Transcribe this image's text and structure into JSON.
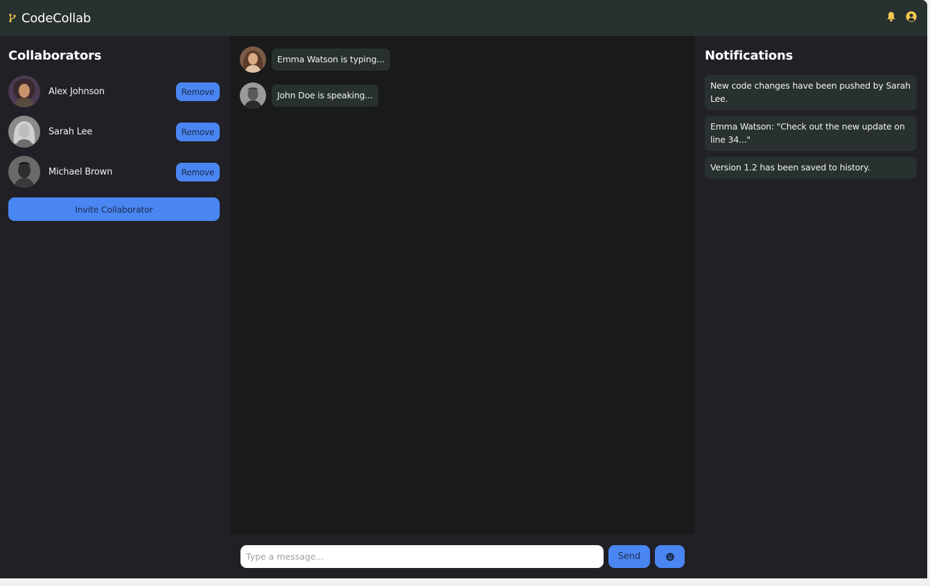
{
  "app": {
    "title": "CodeCollab"
  },
  "collaborators": {
    "title": "Collaborators",
    "items": [
      {
        "name": "Alex Johnson",
        "action": "Remove"
      },
      {
        "name": "Sarah Lee",
        "action": "Remove"
      },
      {
        "name": "Michael Brown",
        "action": "Remove"
      }
    ],
    "invite_label": "Invite Collaborator"
  },
  "chat": {
    "messages": [
      {
        "text": "Emma Watson is typing..."
      },
      {
        "text": "John Doe is speaking..."
      }
    ],
    "input_placeholder": "Type a message...",
    "send_label": "Send"
  },
  "notifications": {
    "title": "Notifications",
    "items": [
      {
        "text": "New code changes have been pushed by Sarah Lee."
      },
      {
        "text": "Emma Watson: \"Check out the new update on line 34...\""
      },
      {
        "text": "Version 1.2 has been saved to history."
      }
    ]
  },
  "colors": {
    "accent": "#4a86f2",
    "icon_yellow": "#f2c94c",
    "topbar": "#283030",
    "panel": "#212027",
    "chat_bg": "#191a1a"
  },
  "icons": {
    "brand": "code-branch-icon",
    "notifications": "bell-icon",
    "account": "user-circle-icon",
    "emoji": "smile-icon"
  }
}
